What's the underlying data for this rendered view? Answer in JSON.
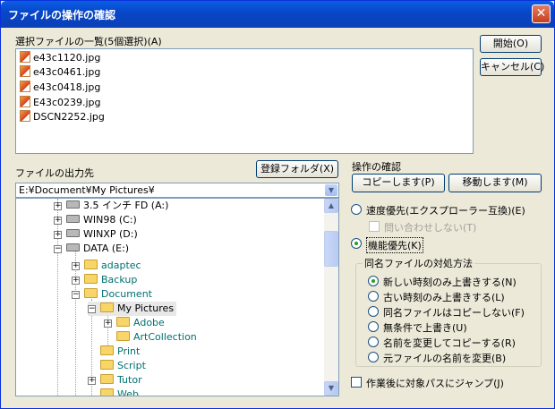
{
  "window": {
    "title": "ファイルの操作の確認",
    "close_glyph": "✕"
  },
  "files_label": "選択ファイルの一覧(5個選択)(A)",
  "files": [
    "e43c1120.jpg",
    "e43c0461.jpg",
    "e43c0418.jpg",
    "E43c0239.jpg",
    "DSCN2252.jpg"
  ],
  "buttons": {
    "start": "開始(O)",
    "cancel": "キャンセル(C)",
    "register_folder": "登録フォルダ(X)",
    "copy": "コピーします(P)",
    "move": "移動します(M)"
  },
  "output_label": "ファイルの出力先",
  "output_path": "E:¥Document¥My Pictures¥",
  "combo_arrow": "▼",
  "tree": [
    {
      "label": "3.5 インチ FD (A:)",
      "kind": "drive",
      "expander": "+"
    },
    {
      "label": "WIN98 (C:)",
      "kind": "drive",
      "expander": "+"
    },
    {
      "label": "WINXP (D:)",
      "kind": "drive",
      "expander": "+"
    },
    {
      "label": "DATA (E:)",
      "kind": "drive",
      "expander": "−"
    },
    {
      "label": "adaptec",
      "kind": "folder",
      "expander": "+"
    },
    {
      "label": "Backup",
      "kind": "folder",
      "expander": "+"
    },
    {
      "label": "Document",
      "kind": "folder",
      "expander": "−"
    },
    {
      "label": "My Pictures",
      "kind": "folder",
      "expander": "−"
    },
    {
      "label": "Adobe",
      "kind": "folder",
      "expander": "+"
    },
    {
      "label": "ArtCollection",
      "kind": "folder",
      "expander": ""
    },
    {
      "label": "Print",
      "kind": "folder",
      "expander": ""
    },
    {
      "label": "Script",
      "kind": "folder",
      "expander": ""
    },
    {
      "label": "Tutor",
      "kind": "folder",
      "expander": "+"
    },
    {
      "label": "Web",
      "kind": "folder",
      "expander": ""
    }
  ],
  "scroll": {
    "up": "▲",
    "down": "▼"
  },
  "operation_label": "操作の確認",
  "options": {
    "speed_priority": "速度優先(エクスプローラー互換)(E)",
    "no_inquiry": "問い合わせしない(T)",
    "function_priority": "機能優先(K)"
  },
  "conflict": {
    "title": "同名ファイルの対処方法",
    "items": [
      "新しい時刻のみ上書きする(N)",
      "古い時刻のみ上書きする(L)",
      "同名ファイルはコピーしない(F)",
      "無条件で上書き(U)",
      "名前を変更してコピーする(R)",
      "元ファイルの名前を変更(B)"
    ]
  },
  "jump_after": "作業後に対象パスにジャンプ(J)"
}
